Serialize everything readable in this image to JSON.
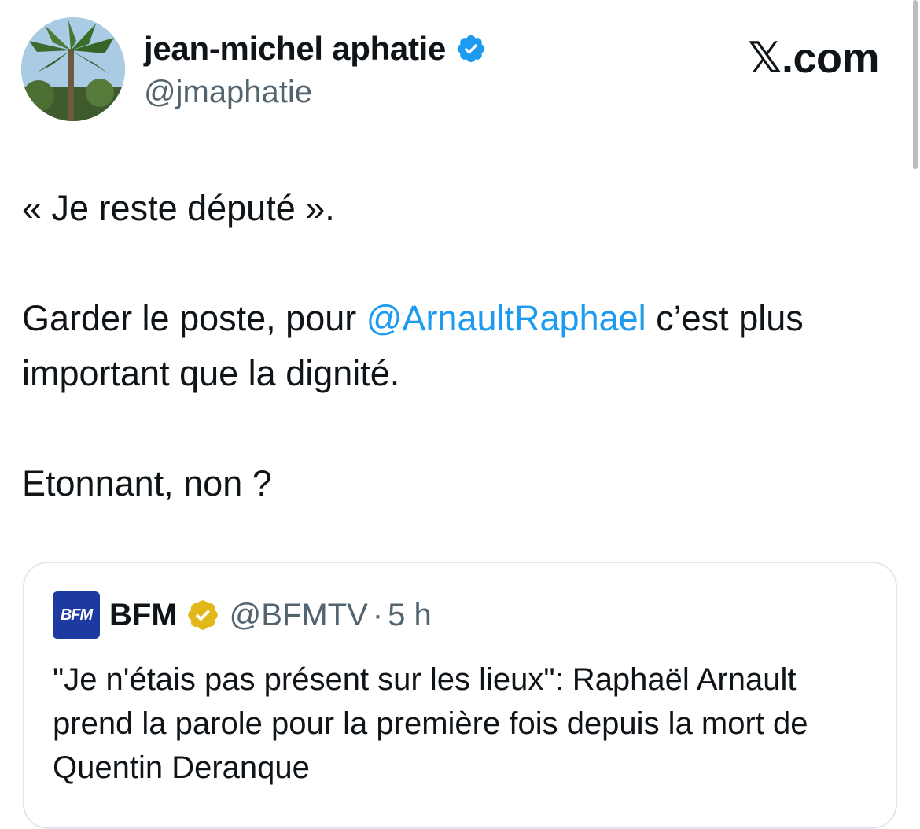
{
  "author": {
    "display_name": "jean-michel aphatie",
    "handle": "@jmaphatie"
  },
  "brand": "𝕏.com",
  "tweet": {
    "line1": "« Je reste député ».",
    "p2_before": "Garder le poste, pour ",
    "p2_mention": "@ArnaultRaphael",
    "p2_after": " c’est plus important que la dignité.",
    "line3": "Etonnant, non ?"
  },
  "quote": {
    "logo_text": "BFM",
    "name": "BFM",
    "handle": "@BFMTV",
    "separator": "·",
    "time": "5 h",
    "text": "\"Je n'étais pas présent sur les lieux\": Raphaël Arnault prend la parole pour la première fois depuis la mort de Quentin Deranque"
  },
  "colors": {
    "mention": "#1d9bf0",
    "verified_blue": "#1d9bf0",
    "verified_gold": "#e2b719",
    "secondary_text": "#536471",
    "bfm_blue": "#1c3aa0"
  },
  "icons": {
    "author_badge": "verified-badge-blue",
    "quote_badge": "verified-badge-gold"
  }
}
